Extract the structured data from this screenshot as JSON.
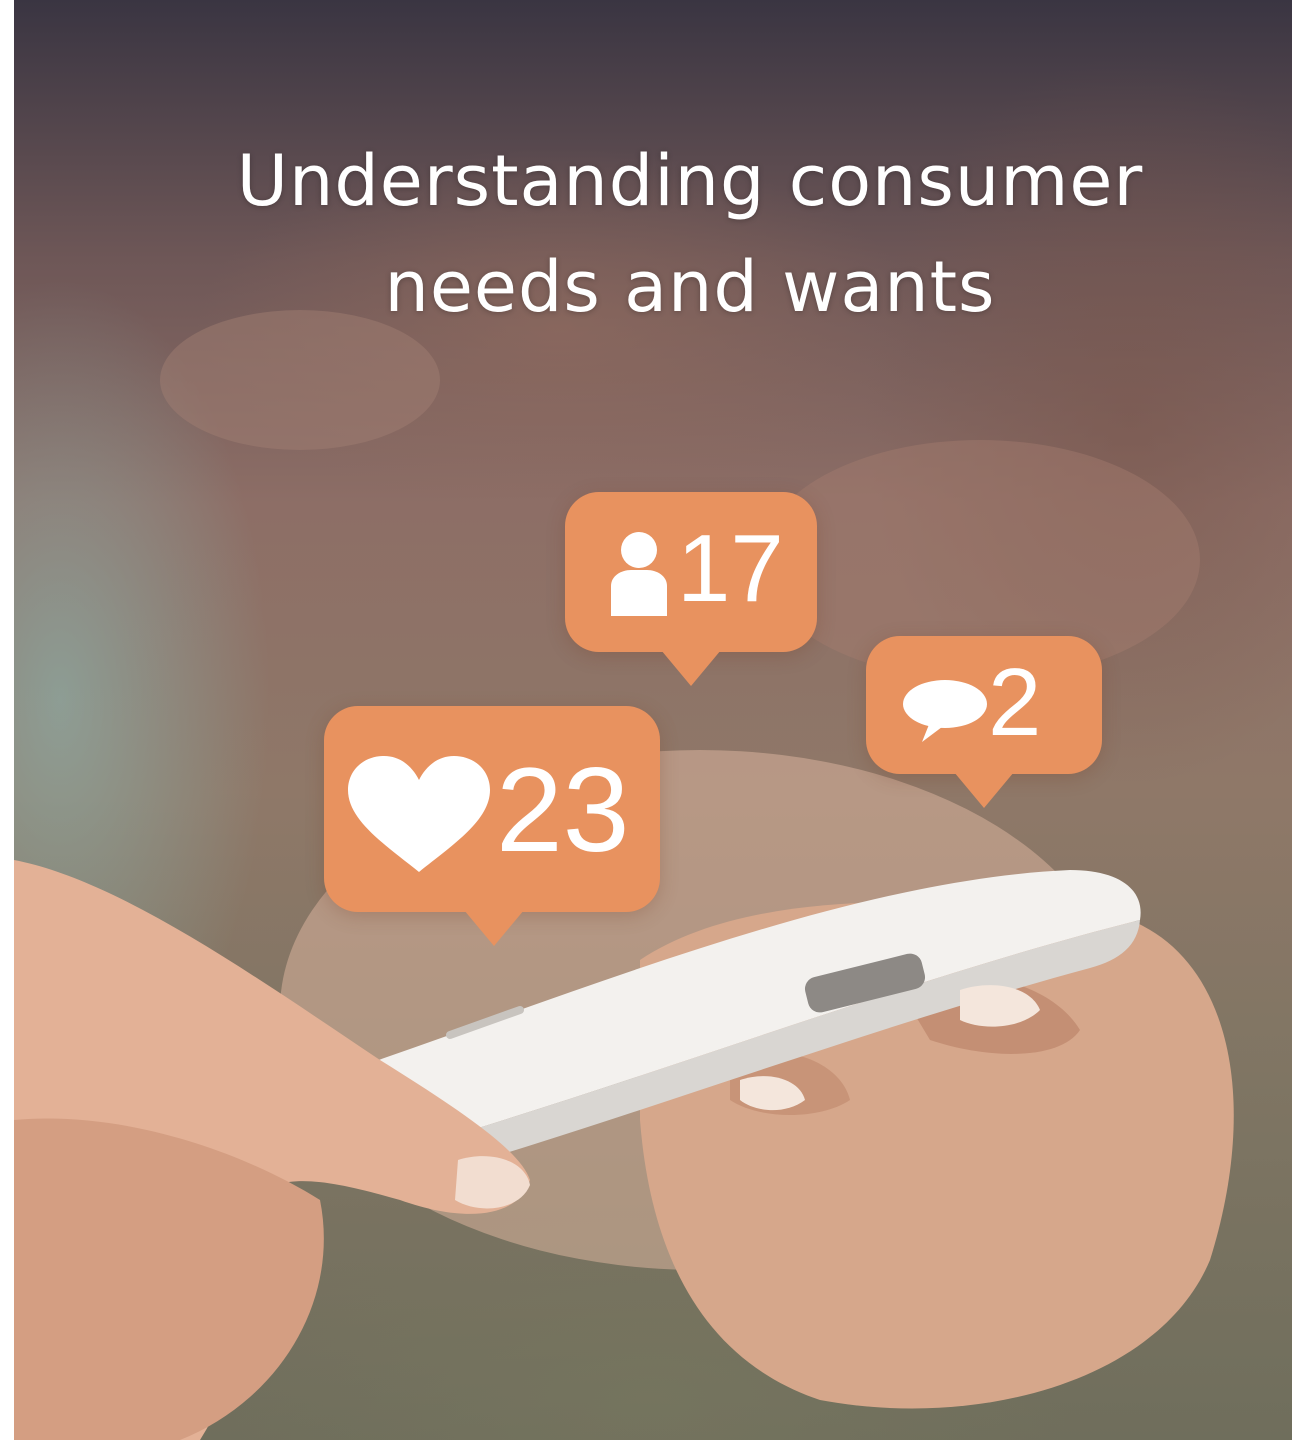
{
  "title": {
    "line1": "Understanding consumer",
    "line2": "needs and wants"
  },
  "notifications": {
    "followers": {
      "icon": "person-icon",
      "count": "17"
    },
    "comments": {
      "icon": "speech-bubble-icon",
      "count": "2"
    },
    "likes": {
      "icon": "heart-icon",
      "count": "23"
    }
  },
  "colors": {
    "bubble": "#e8925f",
    "title_text": "#ffffff"
  }
}
